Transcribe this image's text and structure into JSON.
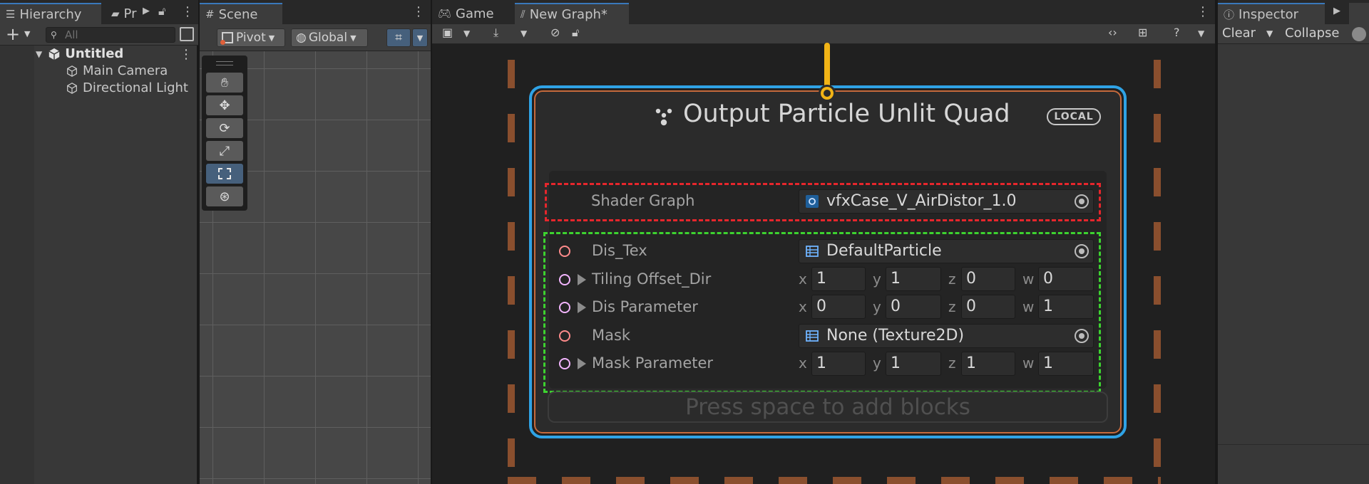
{
  "hierarchy": {
    "tab_label": "Hierarchy",
    "tab2_label": "Pr",
    "search_placeholder": "All",
    "scene_name": "Untitled",
    "items": [
      {
        "label": "Main Camera"
      },
      {
        "label": "Directional Light"
      }
    ]
  },
  "scene": {
    "tab_label": "Scene",
    "pivot_label": "Pivot",
    "global_label": "Global"
  },
  "graph": {
    "tabs": [
      {
        "label": "Game"
      },
      {
        "label": "New Graph*"
      }
    ],
    "node": {
      "title": "Output Particle Unlit Quad",
      "badge": "LOCAL",
      "shader_graph_label": "Shader Graph",
      "shader_graph_value": "vfxCase_V_AirDistor_1.0",
      "properties": [
        {
          "label": "Dis_Tex",
          "value": "DefaultParticle"
        },
        {
          "label": "Tiling Offset_Dir",
          "x": "1",
          "y": "1",
          "z": "0",
          "w": "0"
        },
        {
          "label": "Dis Parameter",
          "x": "0",
          "y": "0",
          "z": "0",
          "w": "1"
        },
        {
          "label": "Mask",
          "value": "None (Texture2D)"
        },
        {
          "label": "Mask Parameter",
          "x": "1",
          "y": "1",
          "z": "1",
          "w": "1"
        }
      ],
      "axis_labels": {
        "x": "x",
        "y": "y",
        "z": "z",
        "w": "w"
      },
      "add_blocks_hint": "Press space to add blocks"
    }
  },
  "inspector": {
    "tab_label": "Inspector",
    "clear_label": "Clear",
    "collapse_label": "Collapse"
  },
  "colors": {
    "selection_blue": "#2fa3e6",
    "node_orange": "#c66a3c",
    "wire_yellow": "#f2b416",
    "annotation_red": "#e6262c",
    "annotation_green": "#3dd230"
  }
}
